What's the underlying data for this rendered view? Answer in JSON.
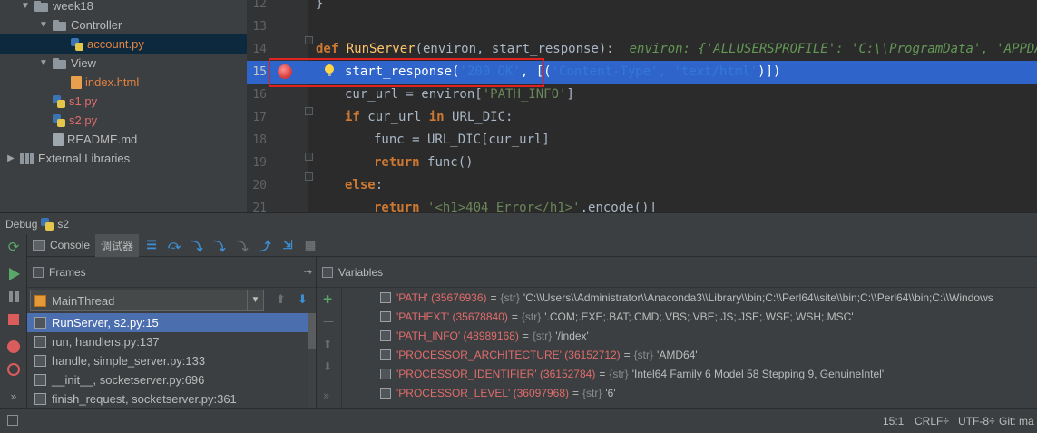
{
  "project_tree": {
    "items": [
      {
        "label": "week18",
        "arrow": "▼",
        "kind": "folder",
        "indent": 1,
        "color": "default"
      },
      {
        "label": "Controller",
        "arrow": "▼",
        "kind": "folder",
        "indent": 2,
        "color": "default"
      },
      {
        "label": "account.py",
        "arrow": "",
        "kind": "py",
        "indent": 3,
        "color": "modified",
        "selected": true
      },
      {
        "label": "View",
        "arrow": "▼",
        "kind": "folder",
        "indent": 2,
        "color": "default"
      },
      {
        "label": "index.html",
        "arrow": "",
        "kind": "html",
        "indent": 3,
        "color": "modified"
      },
      {
        "label": "s1.py",
        "arrow": "",
        "kind": "py",
        "indent": 2,
        "color": "red"
      },
      {
        "label": "s2.py",
        "arrow": "",
        "kind": "py",
        "indent": 2,
        "color": "red"
      },
      {
        "label": "README.md",
        "arrow": "",
        "kind": "md",
        "indent": 2,
        "color": "default"
      },
      {
        "label": "External Libraries",
        "arrow": "▶",
        "kind": "lib",
        "indent": 0,
        "color": "default"
      }
    ]
  },
  "editor": {
    "lines": [
      {
        "num": "12",
        "tokens": [
          {
            "t": "}",
            "c": "sym"
          }
        ],
        "indent": 0
      },
      {
        "num": "13",
        "tokens": [],
        "indent": 0
      },
      {
        "num": "14",
        "tokens": [
          {
            "t": "def ",
            "c": "kw"
          },
          {
            "t": "RunServer",
            "c": "fn"
          },
          {
            "t": "(environ, start_response):",
            "c": "sym"
          },
          {
            "t": "  environ: {'ALLUSERSPROFILE': 'C:\\\\ProgramData', 'APPDATA': 'C:\\\\",
            "c": "hint"
          }
        ],
        "indent": 0
      },
      {
        "num": "15",
        "tokens": [
          {
            "t": "start_response(",
            "c": "curtext"
          },
          {
            "t": "'200 OK'",
            "c": "dimtext"
          },
          {
            "t": ", [(",
            "c": "curtext"
          },
          {
            "t": "'Content-Type', 'text/html'",
            "c": "dimtext"
          },
          {
            "t": ")])",
            "c": "curtext"
          }
        ],
        "indent": 1,
        "current": true
      },
      {
        "num": "16",
        "tokens": [
          {
            "t": "cur_url = environ[",
            "c": "sym"
          },
          {
            "t": "'PATH_INFO'",
            "c": "str"
          },
          {
            "t": "]",
            "c": "sym"
          }
        ],
        "indent": 1
      },
      {
        "num": "17",
        "tokens": [
          {
            "t": "if ",
            "c": "kw"
          },
          {
            "t": "cur_url ",
            "c": "sym"
          },
          {
            "t": "in ",
            "c": "kw"
          },
          {
            "t": "URL_DIC:",
            "c": "sym"
          }
        ],
        "indent": 1
      },
      {
        "num": "18",
        "tokens": [
          {
            "t": "func = URL_DIC[cur_url]",
            "c": "sym"
          }
        ],
        "indent": 2
      },
      {
        "num": "19",
        "tokens": [
          {
            "t": "return ",
            "c": "kw"
          },
          {
            "t": "func()",
            "c": "sym"
          }
        ],
        "indent": 2
      },
      {
        "num": "20",
        "tokens": [
          {
            "t": "else",
            "c": "kw"
          },
          {
            "t": ":",
            "c": "sym"
          }
        ],
        "indent": 1
      },
      {
        "num": "21",
        "tokens": [
          {
            "t": "return ",
            "c": "kw"
          },
          {
            "t": "'<h1>404 Error</h1>'",
            "c": "str"
          },
          {
            "t": ".encode()]",
            "c": "sym"
          }
        ],
        "indent": 2
      }
    ]
  },
  "debug": {
    "title": "Debug",
    "config_name": "s2",
    "tabs": [
      {
        "label": "Console"
      },
      {
        "label": "调试器"
      }
    ],
    "toolbar_icons": [
      "show-execution-point-icon",
      "step-over-icon",
      "step-into-icon",
      "step-into-my-code-icon",
      "force-step-into-icon",
      "step-out-icon",
      "run-to-cursor-icon",
      "evaluate-expression-icon"
    ]
  },
  "frames": {
    "header": "Frames",
    "thread": "MainThread",
    "items": [
      {
        "label": "RunServer, s2.py:15",
        "selected": true
      },
      {
        "label": "run, handlers.py:137"
      },
      {
        "label": "handle, simple_server.py:133"
      },
      {
        "label": "__init__, socketserver.py:696"
      },
      {
        "label": "finish_request, socketserver.py:361"
      }
    ]
  },
  "variables": {
    "header": "Variables",
    "items": [
      {
        "name": "'PATH' (35676936)",
        "type": "{str}",
        "value": "'C:\\\\Users\\\\Administrator\\\\Anaconda3\\\\Library\\\\bin;C:\\\\Perl64\\\\site\\\\bin;C:\\\\Perl64\\\\bin;C:\\\\Windows"
      },
      {
        "name": "'PATHEXT' (35678840)",
        "type": "{str}",
        "value": "'.COM;.EXE;.BAT;.CMD;.VBS;.VBE;.JS;.JSE;.WSF;.WSH;.MSC'"
      },
      {
        "name": "'PATH_INFO' (48989168)",
        "type": "{str}",
        "value": "'/index'"
      },
      {
        "name": "'PROCESSOR_ARCHITECTURE' (36152712)",
        "type": "{str}",
        "value": "'AMD64'"
      },
      {
        "name": "'PROCESSOR_IDENTIFIER' (36152784)",
        "type": "{str}",
        "value": "'Intel64 Family 6 Model 58 Stepping 9, GenuineIntel'"
      },
      {
        "name": "'PROCESSOR_LEVEL' (36097968)",
        "type": "{str}",
        "value": "'6'"
      }
    ]
  },
  "status_bar": {
    "position": "15:1",
    "line_separator": "CRLF÷",
    "encoding": "UTF-8÷",
    "vcs": "Git: ma"
  },
  "colors": {
    "accent_blue": "#2f65ca",
    "breakpoint_red": "#d43c3c",
    "highlight_box": "#e02222"
  }
}
